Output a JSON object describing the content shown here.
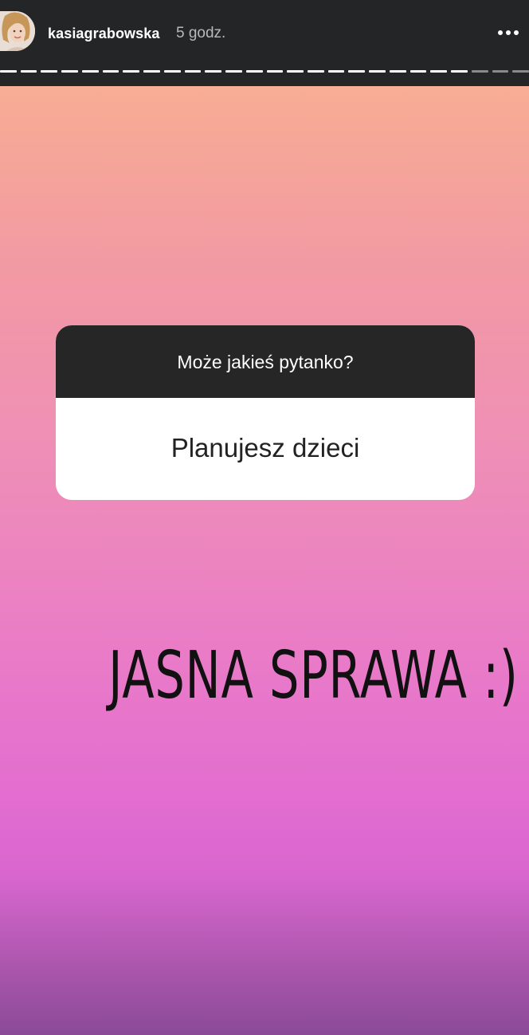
{
  "header": {
    "username": "kasiagrabowska",
    "timestamp": "5 godz.",
    "more_icon": "more-horizontal-icon",
    "progress": {
      "segments": 26,
      "seen": 23
    }
  },
  "question_sticker": {
    "prompt": "Może jakieś pytanko?",
    "answer": "Planujesz dzieci"
  },
  "story_text": "JASNA SPRAWA :)",
  "colors": {
    "top_bar": "#242526",
    "gradient_top": "#f9b894",
    "gradient_mid": "#ea7dc6",
    "gradient_bottom": "#8a4a96",
    "sticker_header": "#262626",
    "sticker_body": "#ffffff"
  }
}
